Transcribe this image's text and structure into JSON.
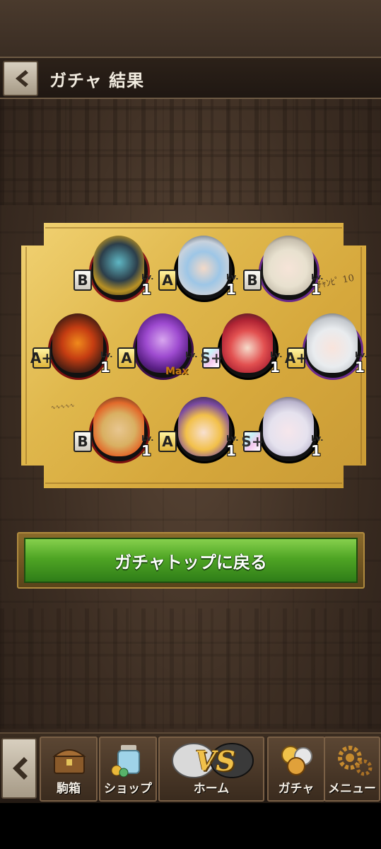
{
  "header": {
    "title": "ガチャ 結果",
    "back_icon": "chevron-left-icon"
  },
  "results": [
    {
      "rank": "B",
      "lv_label": "Lv.",
      "level": "1",
      "max": ""
    },
    {
      "rank": "A",
      "lv_label": "Lv.",
      "level": "1",
      "max": ""
    },
    {
      "rank": "B",
      "lv_label": "Lv.",
      "level": "1",
      "max": ""
    },
    {
      "rank": "A+",
      "lv_label": "Lv.",
      "level": "1",
      "max": ""
    },
    {
      "rank": "A",
      "lv_label": "Lv.",
      "level": "",
      "max": "Max"
    },
    {
      "rank": "S+",
      "lv_label": "Lv.",
      "level": "1",
      "max": ""
    },
    {
      "rank": "A+",
      "lv_label": "Lv.",
      "level": "1",
      "max": ""
    },
    {
      "rank": "B",
      "lv_label": "Lv.",
      "level": "1",
      "max": ""
    },
    {
      "rank": "A",
      "lv_label": "Lv.",
      "level": "1",
      "max": ""
    },
    {
      "rank": "S+",
      "lv_label": "Lv.",
      "level": "1",
      "max": ""
    }
  ],
  "return_button": {
    "label": "ガチャトップに戻る"
  },
  "nav": {
    "box": "駒箱",
    "shop": "ショップ",
    "home": "ホーム",
    "vs": "VS",
    "gacha": "ガチャ",
    "menu": "メニュー"
  },
  "colors": {
    "panel_gold": "#e0b84d",
    "button_green": "#4fa524",
    "stone_brown": "#3d2e23"
  }
}
